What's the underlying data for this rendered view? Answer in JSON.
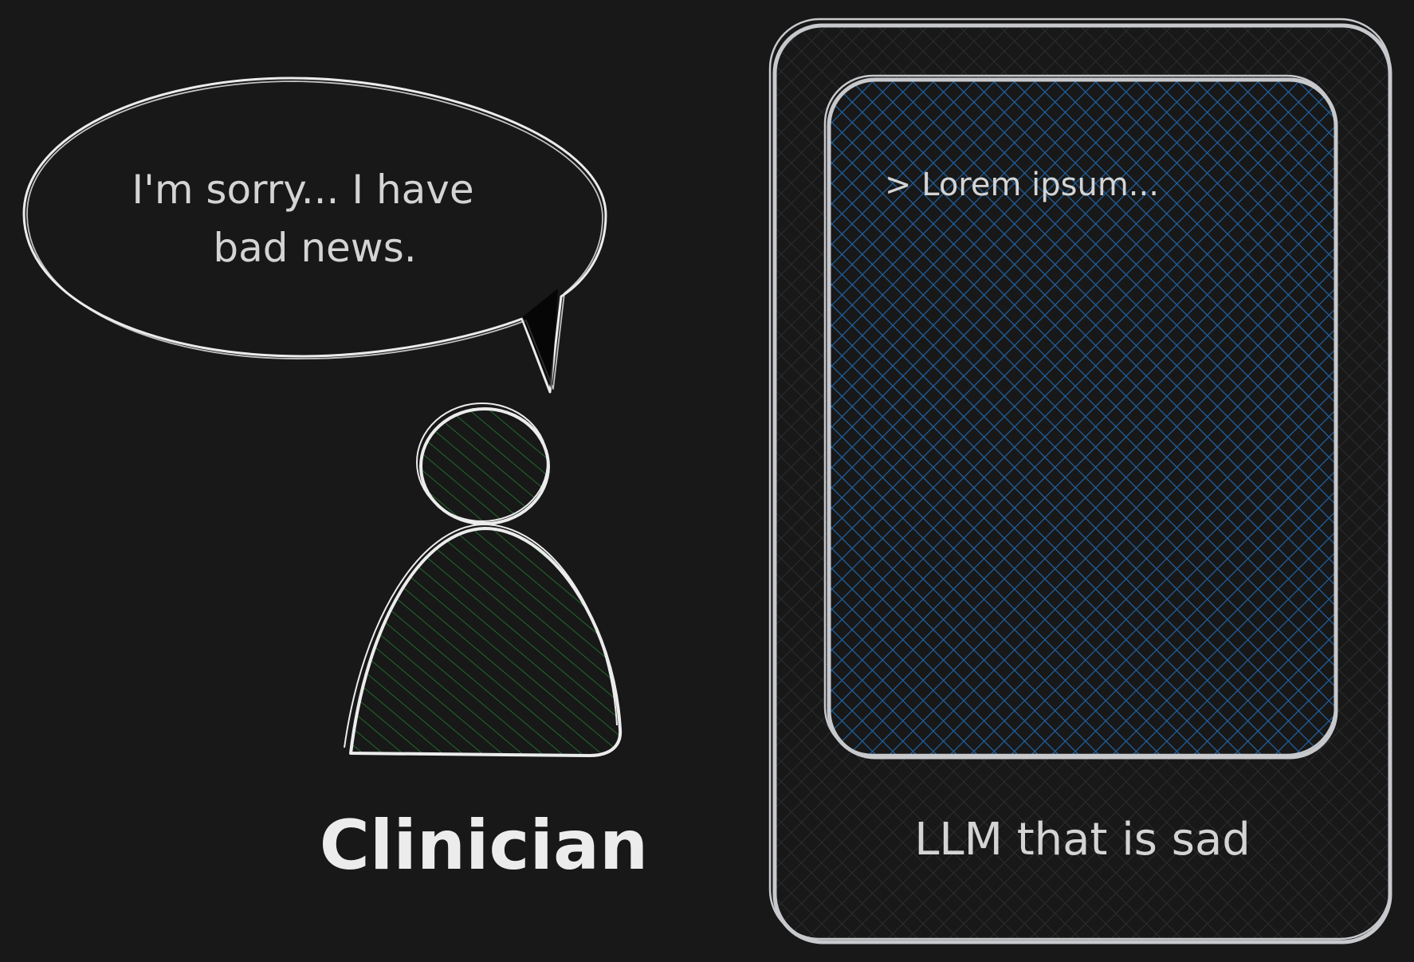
{
  "speech_bubble": {
    "line1": "I'm sorry... I have",
    "line2": "bad news."
  },
  "clinician": {
    "label": "Clinician",
    "fill_color": "#1f6b2a"
  },
  "llm_device": {
    "screen_text": "> Lorem ipsum...",
    "label": "LLM that is sad",
    "screen_color": "#1f5f9e"
  },
  "colors": {
    "background": "#181818",
    "stroke": "#ececec",
    "device_stroke": "#c7c9cc",
    "text": "#d4d4d4"
  }
}
